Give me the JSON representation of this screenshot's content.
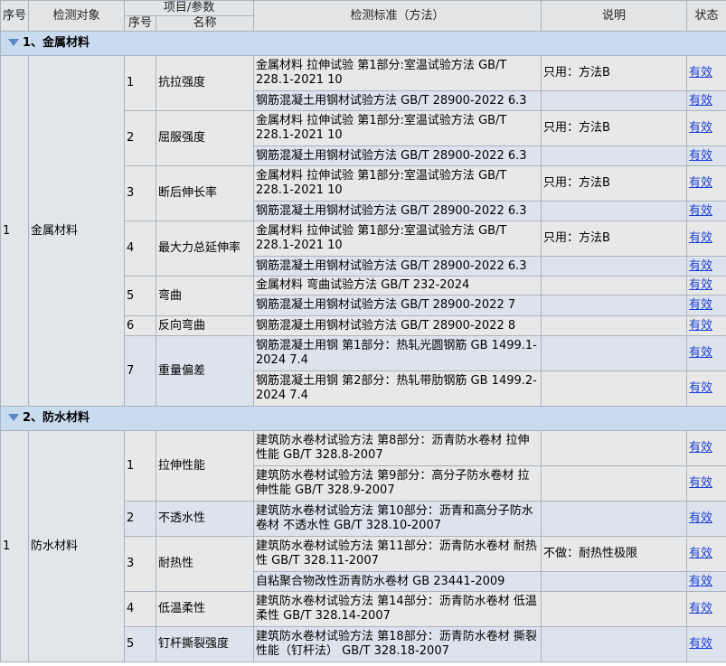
{
  "header": {
    "seq": "序号",
    "object": "检测对象",
    "param_group": "项目/参数",
    "sub_seq": "序号",
    "name": "名称",
    "standard": "检测标准（方法）",
    "note": "说明",
    "status": "状态"
  },
  "sections": [
    {
      "title": "1、金属材料",
      "seq": "1",
      "object": "金属材料",
      "params": [
        {
          "no": "1",
          "name": "抗拉强度",
          "standards": [
            {
              "text": "金属材料 拉伸试验 第1部分:室温试验方法 GB/T 228.1-2021 10",
              "note": "只用：方法B",
              "status": "有效"
            },
            {
              "text": "钢筋混凝土用钢材试验方法 GB/T 28900-2022 6.3",
              "note": "",
              "status": "有效"
            }
          ]
        },
        {
          "no": "2",
          "name": "屈服强度",
          "standards": [
            {
              "text": "金属材料 拉伸试验 第1部分:室温试验方法 GB/T 228.1-2021 10",
              "note": "只用：方法B",
              "status": "有效"
            },
            {
              "text": "钢筋混凝土用钢材试验方法 GB/T 28900-2022 6.3",
              "note": "",
              "status": "有效"
            }
          ]
        },
        {
          "no": "3",
          "name": "断后伸长率",
          "standards": [
            {
              "text": "金属材料 拉伸试验 第1部分:室温试验方法 GB/T 228.1-2021 10",
              "note": "只用：方法B",
              "status": "有效"
            },
            {
              "text": "钢筋混凝土用钢材试验方法 GB/T 28900-2022 6.3",
              "note": "",
              "status": "有效"
            }
          ]
        },
        {
          "no": "4",
          "name": "最大力总延伸率",
          "standards": [
            {
              "text": "金属材料 拉伸试验 第1部分:室温试验方法 GB/T 228.1-2021 10",
              "note": "只用：方法B",
              "status": "有效"
            },
            {
              "text": "钢筋混凝土用钢材试验方法 GB/T 28900-2022 6.3",
              "note": "",
              "status": "有效"
            }
          ]
        },
        {
          "no": "5",
          "name": "弯曲",
          "standards": [
            {
              "text": "金属材料 弯曲试验方法 GB/T 232-2024",
              "note": "",
              "status": "有效"
            },
            {
              "text": "钢筋混凝土用钢材试验方法 GB/T 28900-2022 7",
              "note": "",
              "status": "有效"
            }
          ]
        },
        {
          "no": "6",
          "name": "反向弯曲",
          "standards": [
            {
              "text": "钢筋混凝土用钢材试验方法 GB/T 28900-2022 8",
              "note": "",
              "status": "有效"
            }
          ]
        },
        {
          "no": "7",
          "name": "重量偏差",
          "standards": [
            {
              "text": "钢筋混凝土用钢 第1部分：热轧光圆钢筋 GB 1499.1-2024 7.4",
              "note": "",
              "status": "有效"
            },
            {
              "text": "钢筋混凝土用钢 第2部分：热轧带肋钢筋 GB 1499.2-2024 7.4",
              "note": "",
              "status": "有效"
            }
          ]
        }
      ]
    },
    {
      "title": "2、防水材料",
      "seq": "1",
      "object": "防水材料",
      "params": [
        {
          "no": "1",
          "name": "拉伸性能",
          "standards": [
            {
              "text": "建筑防水卷材试验方法 第8部分：沥青防水卷材 拉伸性能 GB/T 328.8-2007",
              "note": "",
              "status": "有效"
            },
            {
              "text": "建筑防水卷材试验方法 第9部分：高分子防水卷材 拉伸性能 GB/T 328.9-2007",
              "note": "",
              "status": "有效"
            }
          ]
        },
        {
          "no": "2",
          "name": "不透水性",
          "standards": [
            {
              "text": "建筑防水卷材试验方法 第10部分：沥青和高分子防水卷材 不透水性 GB/T 328.10-2007",
              "note": "",
              "status": "有效"
            }
          ]
        },
        {
          "no": "3",
          "name": "耐热性",
          "standards": [
            {
              "text": "建筑防水卷材试验方法 第11部分：沥青防水卷材 耐热性 GB/T 328.11-2007",
              "note": "不做：耐热性极限",
              "status": "有效"
            },
            {
              "text": "自粘聚合物改性沥青防水卷材 GB 23441-2009",
              "note": "",
              "status": "有效"
            }
          ]
        },
        {
          "no": "4",
          "name": "低温柔性",
          "standards": [
            {
              "text": "建筑防水卷材试验方法 第14部分：沥青防水卷材 低温柔性 GB/T 328.14-2007",
              "note": "",
              "status": "有效"
            }
          ]
        },
        {
          "no": "5",
          "name": "钉杆撕裂强度",
          "standards": [
            {
              "text": "建筑防水卷材试验方法 第18部分：沥青防水卷材 撕裂性能（钉杆法） GB/T 328.18-2007",
              "note": "",
              "status": "有效"
            }
          ]
        }
      ]
    }
  ]
}
